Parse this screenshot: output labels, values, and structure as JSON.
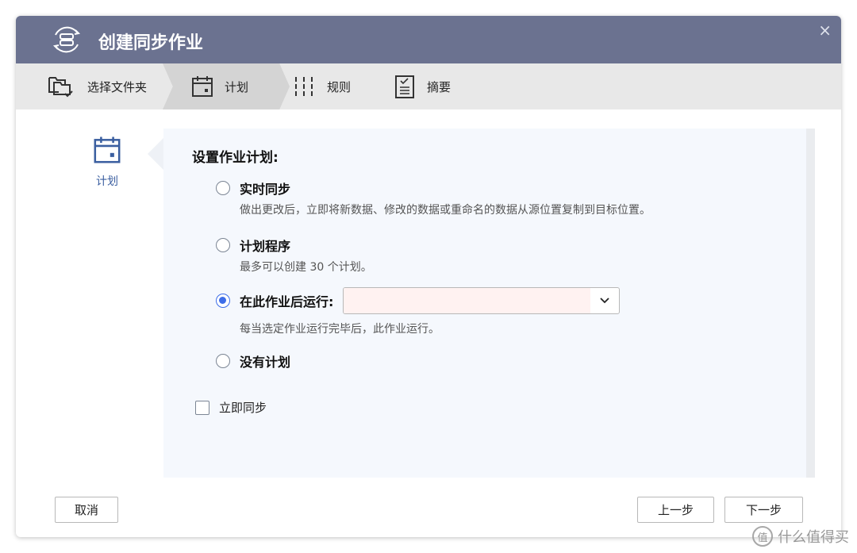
{
  "header": {
    "title": "创建同步作业",
    "close": "×"
  },
  "steps": [
    {
      "label": "选择文件夹"
    },
    {
      "label": "计划"
    },
    {
      "label": "规则"
    },
    {
      "label": "摘要"
    }
  ],
  "left": {
    "label": "计划"
  },
  "main": {
    "heading": "设置作业计划:",
    "options": [
      {
        "label": "实时同步",
        "desc": "做出更改后，立即将新数据、修改的数据或重命名的数据从源位置复制到目标位置。",
        "selected": false
      },
      {
        "label": "计划程序",
        "desc": "最多可以创建 30 个计划。",
        "selected": false
      },
      {
        "label": "在此作业后运行:",
        "desc": "每当选定作业运行完毕后，此作业运行。",
        "selected": true
      },
      {
        "label": "没有计划",
        "selected": false
      }
    ],
    "sync_now": {
      "label": "立即同步",
      "checked": false
    }
  },
  "footer": {
    "cancel": "取消",
    "back": "上一步",
    "next": "下一步"
  },
  "watermark": {
    "icon": "值",
    "text": "什么值得买"
  },
  "colors": {
    "header": "#6b7290",
    "accent": "#3d6de8"
  }
}
